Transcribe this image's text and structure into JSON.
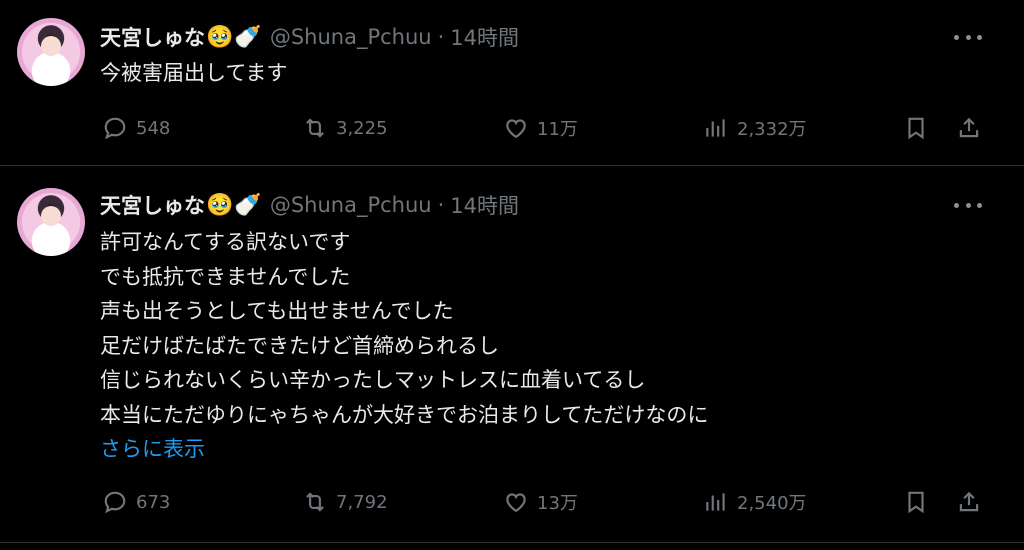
{
  "colors": {
    "background": "#000000",
    "text": "#e7e9ea",
    "secondary": "#71767b",
    "link": "#1d9bf0",
    "divider": "#2f3336"
  },
  "tweets": [
    {
      "display_name": "天宮しゅな",
      "badges": [
        "🥹",
        "🍼"
      ],
      "handle": "@Shuna_Pchuu",
      "separator": "·",
      "time": "14時間",
      "text_lines": [
        "今被害届出してます"
      ],
      "replies": "548",
      "retweets": "3,225",
      "likes": "11万",
      "views": "2,332万"
    },
    {
      "display_name": "天宮しゅな",
      "badges": [
        "🥹",
        "🍼"
      ],
      "handle": "@Shuna_Pchuu",
      "separator": "·",
      "time": "14時間",
      "text_lines": [
        "許可なんてする訳ないです",
        "でも抵抗できませんでした",
        "声も出そうとしても出せませんでした",
        "足だけばたばたできたけど首締められるし",
        "信じられないくらい辛かったしマットレスに血着いてるし",
        "本当にただゆりにゃちゃんが大好きでお泊まりしてただけなのに"
      ],
      "show_more": "さらに表示",
      "replies": "673",
      "retweets": "7,792",
      "likes": "13万",
      "views": "2,540万"
    }
  ],
  "icons": {
    "reply": "reply-icon",
    "retweet": "retweet-icon",
    "like": "heart-icon",
    "views": "views-icon",
    "bookmark": "bookmark-icon",
    "share": "share-icon",
    "more": "more-icon"
  }
}
